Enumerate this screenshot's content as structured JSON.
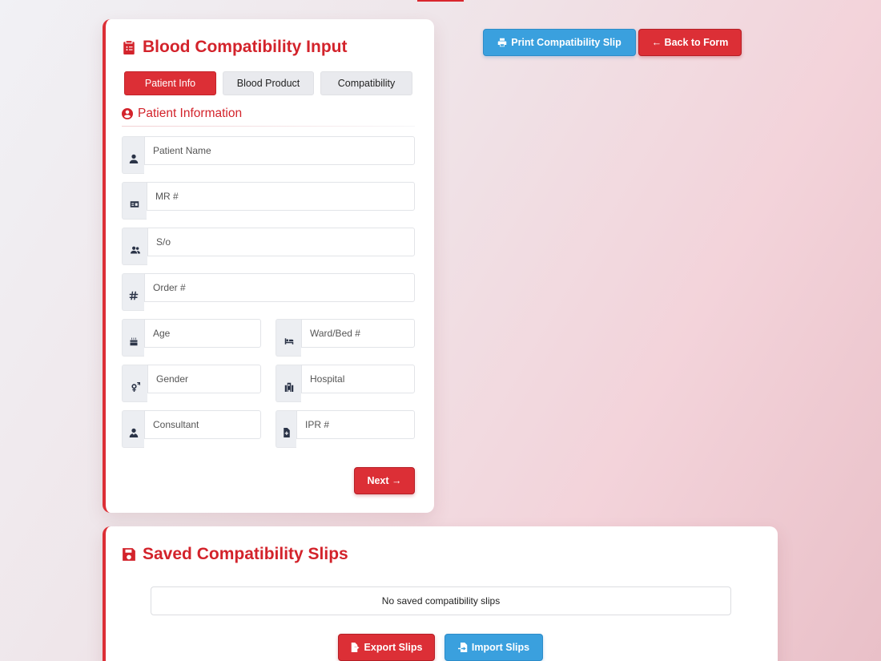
{
  "input_card": {
    "title": "Blood Compatibility Input",
    "title_icon": "clipboard-list-icon",
    "tabs": [
      {
        "label": "Patient Info",
        "active": true
      },
      {
        "label": "Blood Product",
        "active": false
      },
      {
        "label": "Compatibility",
        "active": false
      }
    ],
    "section_title": "Patient Information",
    "section_icon": "user-circle-icon",
    "fields": {
      "patient_name": {
        "placeholder": "Patient Name",
        "value": "",
        "icon": "user-icon"
      },
      "mr_number": {
        "placeholder": "MR #",
        "value": "",
        "icon": "id-card-icon"
      },
      "so": {
        "placeholder": "S/o",
        "value": "",
        "icon": "users-icon"
      },
      "order_number": {
        "placeholder": "Order #",
        "value": "",
        "icon": "hashtag-icon"
      },
      "age": {
        "placeholder": "Age",
        "value": "",
        "icon": "birthday-cake-icon"
      },
      "ward_bed": {
        "placeholder": "Ward/Bed #",
        "value": "",
        "icon": "bed-icon"
      },
      "gender": {
        "placeholder": "Gender",
        "value": "",
        "icon": "venus-mars-icon"
      },
      "hospital": {
        "placeholder": "Hospital",
        "value": "",
        "icon": "hospital-icon"
      },
      "consultant": {
        "placeholder": "Consultant",
        "value": "",
        "icon": "user-doctor-icon"
      },
      "ipr_number": {
        "placeholder": "IPR #",
        "value": "",
        "icon": "file-medical-icon"
      }
    },
    "next_label": "Next →"
  },
  "toolbar": {
    "print_label": "Print Compatibility Slip",
    "back_label": "← Back to Form"
  },
  "saved": {
    "title": "Saved Compatibility Slips",
    "title_icon": "save-icon",
    "empty_text": "No saved compatibility slips",
    "export_label": "Export Slips",
    "import_label": "Import Slips"
  },
  "colors": {
    "accent_red": "#dc2f36",
    "accent_blue": "#3aa0de"
  }
}
